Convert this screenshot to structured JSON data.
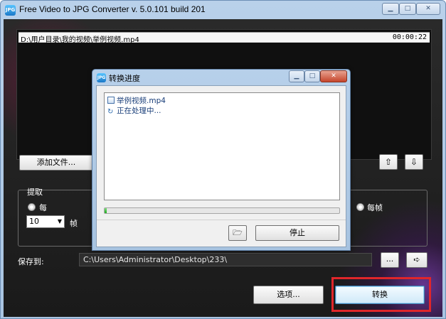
{
  "window": {
    "title": "Free Video to JPG Converter  v. 5.0.101 build 201",
    "app_icon": "JPG",
    "controls": {
      "minimize": "▁",
      "maximize": "□",
      "close": "✕"
    }
  },
  "files": [
    {
      "path": "D:\\用户目录\\我的视频\\举例视频.mp4",
      "duration": "00:00:22"
    }
  ],
  "buttons": {
    "add_files": "添加文件...",
    "move_up": "⇧",
    "move_down": "⇩",
    "browse": "...",
    "open_folder": "➪",
    "options": "选项...",
    "convert": "转换"
  },
  "extract": {
    "label": "提取",
    "every_option": "每",
    "interval_value": "10",
    "interval_unit": "帧",
    "every_frame_option": "每帧"
  },
  "save": {
    "label": "保存到:",
    "path": "C:\\Users\\Administrator\\Desktop\\233\\"
  },
  "dialog": {
    "title": "转换进度",
    "icon": "JPG",
    "controls": {
      "minimize": "▁",
      "maximize": "□",
      "close": "✕"
    },
    "task_file": "举例视频.mp4",
    "task_status": "正在处理中...",
    "progress": 0.01,
    "folder_button": "🗁",
    "stop_button": "停止"
  },
  "colors": {
    "highlight_border": "#e0262a",
    "progress_green": "#1fa81f"
  }
}
